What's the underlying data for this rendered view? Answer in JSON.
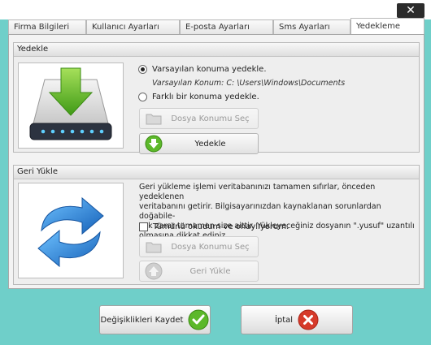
{
  "close_symbol": "✕",
  "tabs": [
    "Firma Bilgileri",
    "Kullanıcı Ayarları",
    "E-posta Ayarları",
    "Sms Ayarları",
    "Yedekleme"
  ],
  "active_tab": "Yedekleme",
  "backup": {
    "title": "Yedekle",
    "icon": "download-drive-icon",
    "option_default": "Varsayılan konuma yedekle.",
    "default_path": "Varsayılan Konum: C: \\Users\\Windows\\Documents",
    "option_other": "Farklı bir konuma yedekle.",
    "select_location_button": "Dosya Konumu Seç",
    "backup_button": "Yedekle",
    "selected_option": "default"
  },
  "restore": {
    "title": "Geri Yükle",
    "icon": "restore-arrows-icon",
    "description_lines": [
      "Geri yükleme işlemi veritabanınızı tamamen sıfırlar, önceden yedeklenen",
      "veritabanını getirir. Bilgisayarınızdan kaynaklanan sorunlardan doğabile-",
      "cek zarar tamamen size aittir. Yükleyeceğiniz dosyanın \".yusuf\" uzantılı",
      "olmasına dikkat ediniz."
    ],
    "confirm_checkbox": "Tümünü okudum ve onaylıyorum.",
    "confirm_checked": false,
    "select_location_button": "Dosya Konumu Seç",
    "restore_button": "Geri Yükle"
  },
  "footer": {
    "save_button": "Değişiklikleri Kaydet",
    "cancel_button": "İptal"
  },
  "colors": {
    "window_background": "#6fcfc9",
    "green_accent": "#5cb82a",
    "blue_arrow": "#1f7fd6",
    "cancel_red": "#d63a2a"
  }
}
